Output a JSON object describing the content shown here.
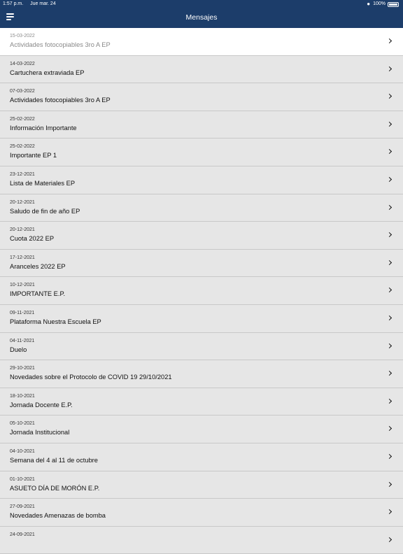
{
  "status_bar": {
    "time": "1:57 p.m.",
    "date": "Jue mar. 24",
    "battery": "100%"
  },
  "header": {
    "title": "Mensajes"
  },
  "messages": [
    {
      "date": "15-03-2022",
      "subject": "Actividades fotocopiables 3ro A EP"
    },
    {
      "date": "14-03-2022",
      "subject": "Cartuchera extraviada EP"
    },
    {
      "date": "07-03-2022",
      "subject": "Actividades fotocopiables 3ro A EP"
    },
    {
      "date": "25-02-2022",
      "subject": "Información Importante"
    },
    {
      "date": "25-02-2022",
      "subject": "Importante EP 1"
    },
    {
      "date": "23-12-2021",
      "subject": "Lista de Materiales EP"
    },
    {
      "date": "20-12-2021",
      "subject": "Saludo de fin de año EP"
    },
    {
      "date": "20-12-2021",
      "subject": "Cuota 2022 EP"
    },
    {
      "date": "17-12-2021",
      "subject": "Aranceles 2022 EP"
    },
    {
      "date": "10-12-2021",
      "subject": "IMPORTANTE E.P."
    },
    {
      "date": "09-11-2021",
      "subject": "Plataforma Nuestra Escuela EP"
    },
    {
      "date": "04-11-2021",
      "subject": "Duelo"
    },
    {
      "date": "29-10-2021",
      "subject": "Novedades sobre el Protocolo de COVID 19 29/10/2021"
    },
    {
      "date": "18-10-2021",
      "subject": "Jornada Docente E.P."
    },
    {
      "date": "05-10-2021",
      "subject": "Jornada Institucional"
    },
    {
      "date": "04-10-2021",
      "subject": "Semana del 4 al 11 de octubre"
    },
    {
      "date": "01-10-2021",
      "subject": "ASUETO DÍA DE MORÓN E.P."
    },
    {
      "date": "27-09-2021",
      "subject": "Novedades Amenazas de bomba"
    },
    {
      "date": "24-09-2021",
      "subject": ""
    }
  ],
  "colors": {
    "header": "#1c3d6a",
    "selected_row": "#ffffff",
    "row": "#e6e6e6"
  },
  "icons": {
    "menu": "menu-icon",
    "row_chevron": "chevron-right-icon",
    "wifi": "wifi-icon",
    "battery": "battery-icon"
  }
}
